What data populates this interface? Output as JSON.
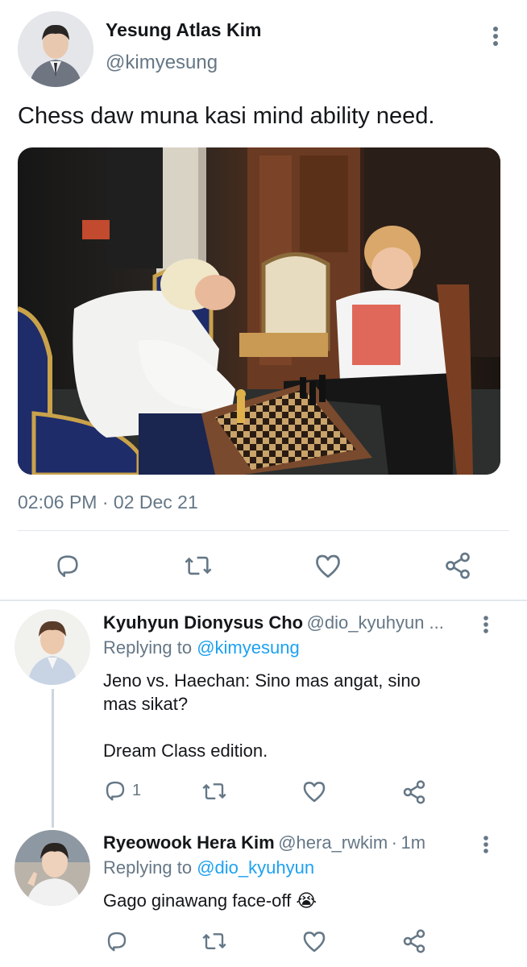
{
  "main_tweet": {
    "author_name": "Yesung Atlas Kim",
    "author_handle": "@kimyesung",
    "text": "Chess daw muna kasi mind ability need.",
    "timestamp": "02:06 PM",
    "separator": "·",
    "date": "02 Dec 21",
    "actions": [
      {
        "icon": "reply-icon"
      },
      {
        "icon": "retweet-icon"
      },
      {
        "icon": "like-icon"
      },
      {
        "icon": "share-icon"
      }
    ]
  },
  "replies": [
    {
      "author_name": "Kyuhyun Dionysus Cho",
      "author_handle": "@dio_kyuhyun ...",
      "replying_prefix": "Replying to",
      "replying_to": "@kimyesung",
      "text_line1": "Jeno vs. Haechan: Sino mas angat, sino",
      "text_line2": "mas sikat?",
      "text_line3": "Dream Class edition.",
      "reply_count": "1"
    },
    {
      "author_name": "Ryeowook Hera Kim",
      "author_handle": "@hera_rwkim",
      "separator": "·",
      "time": "1m",
      "replying_prefix": "Replying to",
      "replying_to": "@dio_kyuhyun",
      "text": "Gago ginawang face-off",
      "emoji": "😭"
    }
  ],
  "colors": {
    "accent": "#1da1f2",
    "muted": "#657786",
    "divider": "#e1e8ed"
  }
}
